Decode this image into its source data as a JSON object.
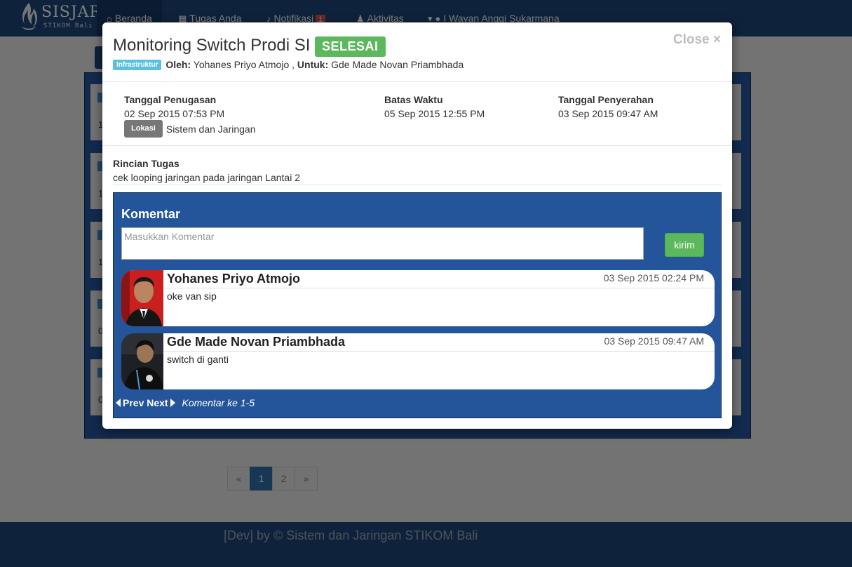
{
  "brand": {
    "name": "SISJAR",
    "sub": "STIKOM Bali"
  },
  "nav": {
    "home": "Beranda",
    "tasks": "Tugas Anda",
    "notifications": "Notifikasi",
    "notification_count": "1",
    "activity": "Aktivitas",
    "user": "I Wayan Anggi Sukarmana"
  },
  "background_rows": [
    "1",
    "1",
    "1",
    "0",
    "0"
  ],
  "pagination": {
    "prev": "«",
    "pages": [
      "1",
      "2"
    ],
    "current": "1",
    "next": "»"
  },
  "footer": "[Dev] by © Sistem dan Jaringan STIKOM Bali",
  "modal": {
    "title": "Monitoring Switch Prodi SI",
    "status": "SELESAI",
    "close": "Close ×",
    "category": "Infrastruktur",
    "by_label": "Oleh:",
    "by": "Yohanes Priyo Atmojo ,",
    "for_label": "Untuk:",
    "for": "Gde Made Novan Priambhada",
    "assigned_label": "Tanggal Penugasan",
    "assigned": "02 Sep 2015 07:53 PM",
    "location_label": "Lokasi",
    "location": "Sistem dan Jaringan",
    "deadline_label": "Batas Waktu",
    "deadline": "05 Sep 2015 12:55 PM",
    "submitted_label": "Tanggal Penyerahan",
    "submitted": "03 Sep 2015 09:47 AM",
    "details_label": "Rincian Tugas",
    "details": "cek looping jaringan pada jaringan Lantai 2"
  },
  "comments": {
    "title": "Komentar",
    "placeholder": "Masukkan Komentar",
    "submit": "kirim",
    "items": [
      {
        "name": "Yohanes Priyo Atmojo",
        "time": "03 Sep 2015 02:24 PM",
        "text": "oke van sip"
      },
      {
        "name": "Gde Made Novan Priambhada",
        "time": "03 Sep 2015 09:47 AM",
        "text": "switch di ganti"
      }
    ],
    "prev": "Prev",
    "next": "Next",
    "range": "Komentar ke 1-5"
  },
  "colors": {
    "navbar": "#1f4577",
    "panel": "#24559a",
    "success": "#5cb85c",
    "info": "#5bc0de"
  }
}
